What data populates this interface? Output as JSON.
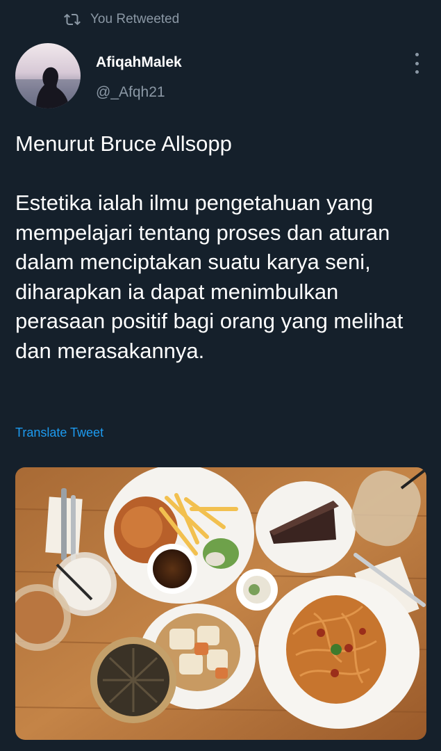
{
  "retweet": {
    "icon": "retweet-icon",
    "label": "You Retweeted"
  },
  "author": {
    "display_name": "AfiqahMalek",
    "handle": "@_Afqh21",
    "avatar_icon": "profile-avatar"
  },
  "more_icon": "more-vertical-icon",
  "tweet": {
    "text": "Menurut Bruce Allsopp\n\nEstetika ialah ilmu pengetahuan yang mempelajari tentang proses dan aturan dalam menciptakan suatu karya seni, diharapkan ia dapat menimbulkan perasaan positif bagi orang yang melihat dan merasakannya.",
    "translate_label": "Translate Tweet",
    "media": "food-photo"
  },
  "colors": {
    "background": "#15202b",
    "text_primary": "#ffffff",
    "text_secondary": "#8b98a5",
    "link": "#1d9bf0"
  }
}
